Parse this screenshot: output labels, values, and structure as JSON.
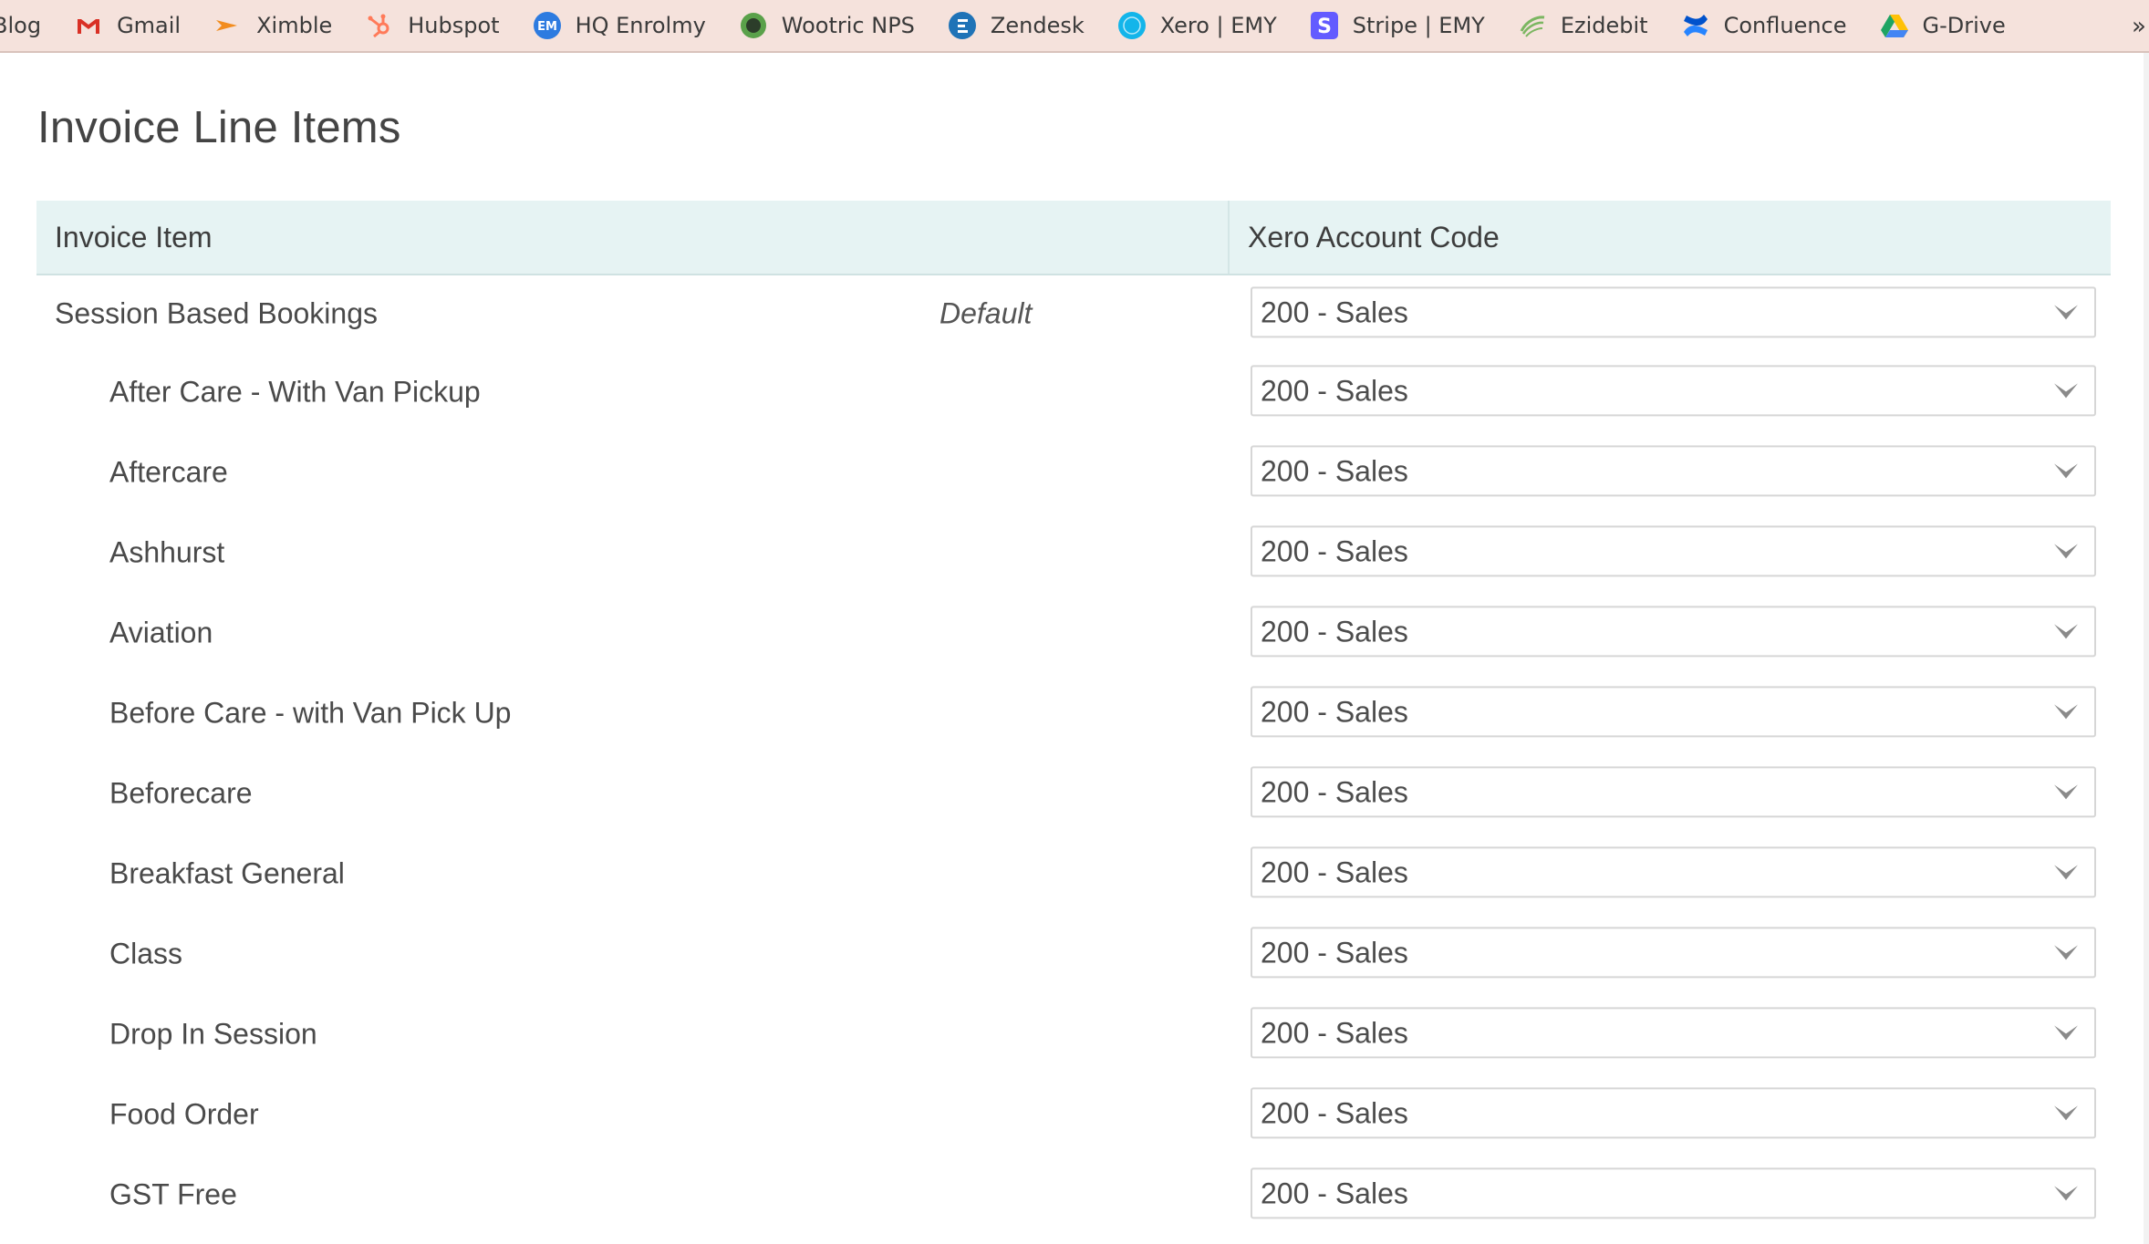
{
  "bookmarks": [
    {
      "label": "Blog",
      "icon": "blog-icon"
    },
    {
      "label": "Gmail",
      "icon": "gmail-icon"
    },
    {
      "label": "Ximble",
      "icon": "ximble-icon"
    },
    {
      "label": "Hubspot",
      "icon": "hubspot-icon"
    },
    {
      "label": "HQ Enrolmy",
      "icon": "enrolmy-icon"
    },
    {
      "label": "Wootric NPS",
      "icon": "wootric-icon"
    },
    {
      "label": "Zendesk",
      "icon": "zendesk-icon"
    },
    {
      "label": "Xero | EMY",
      "icon": "xero-icon"
    },
    {
      "label": "Stripe | EMY",
      "icon": "stripe-icon"
    },
    {
      "label": "Ezidebit",
      "icon": "ezidebit-icon"
    },
    {
      "label": "Confluence",
      "icon": "confluence-icon"
    },
    {
      "label": "G-Drive",
      "icon": "google-drive-icon"
    }
  ],
  "overflow": "»",
  "page": {
    "title": "Invoice Line Items"
  },
  "table": {
    "headers": {
      "item": "Invoice Item",
      "code": "Xero Account Code"
    },
    "rows": [
      {
        "label": "Session Based Bookings",
        "level": "top",
        "tag": "Default",
        "code": "200 - Sales"
      },
      {
        "label": "After Care - With Van Pickup",
        "level": "child",
        "code": "200 - Sales"
      },
      {
        "label": "Aftercare",
        "level": "child",
        "code": "200 - Sales"
      },
      {
        "label": "Ashhurst",
        "level": "child",
        "code": "200 - Sales"
      },
      {
        "label": "Aviation",
        "level": "child",
        "code": "200 - Sales"
      },
      {
        "label": "Before Care - with Van Pick Up",
        "level": "child",
        "code": "200 - Sales"
      },
      {
        "label": "Beforecare",
        "level": "child",
        "code": "200 - Sales"
      },
      {
        "label": "Breakfast General",
        "level": "child",
        "code": "200 - Sales"
      },
      {
        "label": "Class",
        "level": "child",
        "code": "200 - Sales"
      },
      {
        "label": "Drop In Session",
        "level": "child",
        "code": "200 - Sales"
      },
      {
        "label": "Food Order",
        "level": "child",
        "code": "200 - Sales"
      },
      {
        "label": "GST Free",
        "level": "child",
        "code": "200 - Sales"
      }
    ]
  },
  "colors": {
    "bookmarks_bar": "#f5e2dc",
    "table_header": "#e6f3f3",
    "gmail": "#d93025",
    "hubspot": "#ff7a59",
    "enrolmy": "#2d7be0",
    "zendesk": "#1f73b7",
    "xero": "#13b5ea",
    "stripe": "#635bff",
    "confluence": "#2684ff"
  }
}
